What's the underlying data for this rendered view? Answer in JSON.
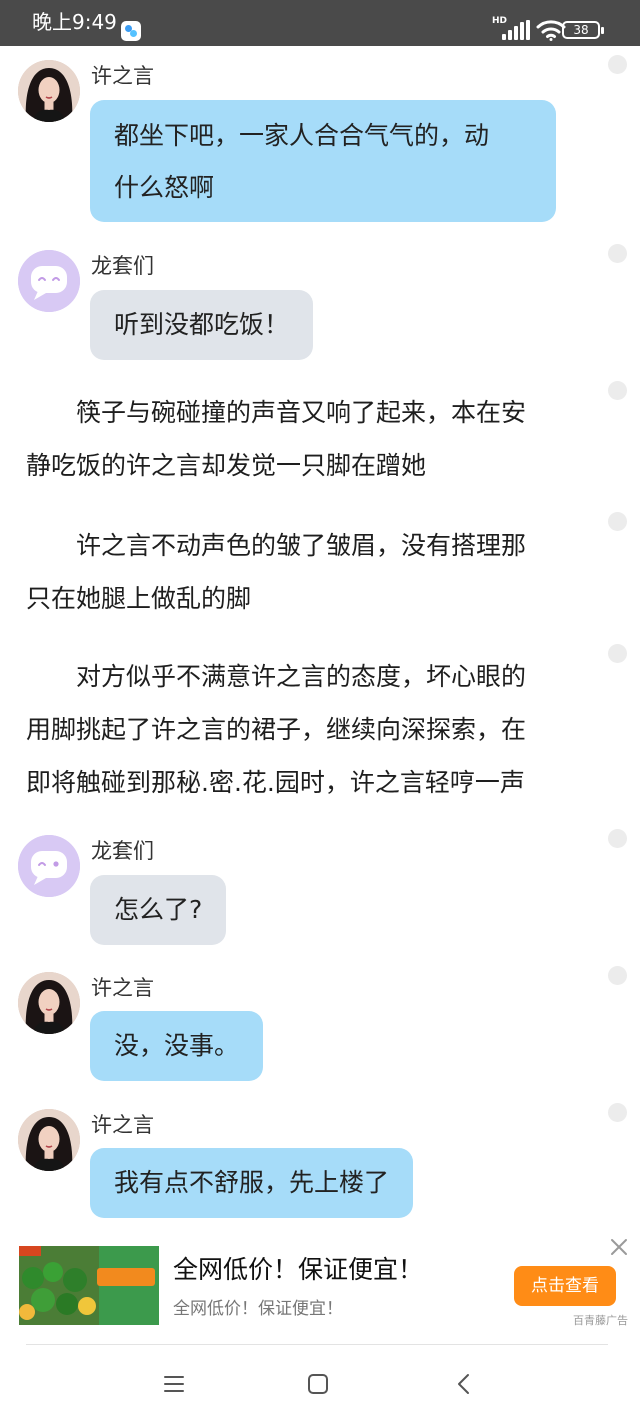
{
  "status_bar": {
    "time": "晚上9:49",
    "network": "HD",
    "battery": "38",
    "icons": [
      "app-notification-icon",
      "signal-icon",
      "wifi-icon",
      "battery-icon"
    ]
  },
  "chat": {
    "msg1": {
      "sender": "许之言",
      "text": [
        "都坐下吧，一家人合合气气的，动",
        "什么怒啊"
      ],
      "avatar": "user-photo-avatar"
    },
    "msg2": {
      "sender": "龙套们",
      "text": "听到没都吃饭！",
      "avatar": "bot-face-avatar"
    },
    "para1": [
      "　　筷子与碗碰撞的声音又响了起来，本在安",
      "静吃饭的许之言却发觉一只脚在蹭她"
    ],
    "para2": [
      "　　许之言不动声色的皱了皱眉，没有搭理那",
      "只在她腿上做乱的脚"
    ],
    "para3": [
      "　　对方似乎不满意许之言的态度，坏心眼的",
      "用脚挑起了许之言的裙子，继续向深探索，在",
      "即将触碰到那秘.密.花.园时，许之言轻哼一声"
    ],
    "msg3": {
      "sender": "龙套们",
      "text": "怎么了?",
      "avatar": "bot-face-avatar"
    },
    "msg4": {
      "sender": "许之言",
      "text": "没，没事。",
      "avatar": "user-photo-avatar"
    },
    "msg5": {
      "sender": "许之言",
      "text": "我有点不舒服，先上楼了",
      "avatar": "user-photo-avatar"
    }
  },
  "ad": {
    "title": "全网低价！保证便宜！",
    "subtitle": "全网低价！保证便宜！",
    "button": "点击查看",
    "source": "百青藤广告"
  },
  "colors": {
    "status_bar": "#4a4a4a",
    "bubble_blue": "#a6dcf9",
    "bubble_grey": "#e0e4ea",
    "ad_button": "#ff8c16"
  }
}
